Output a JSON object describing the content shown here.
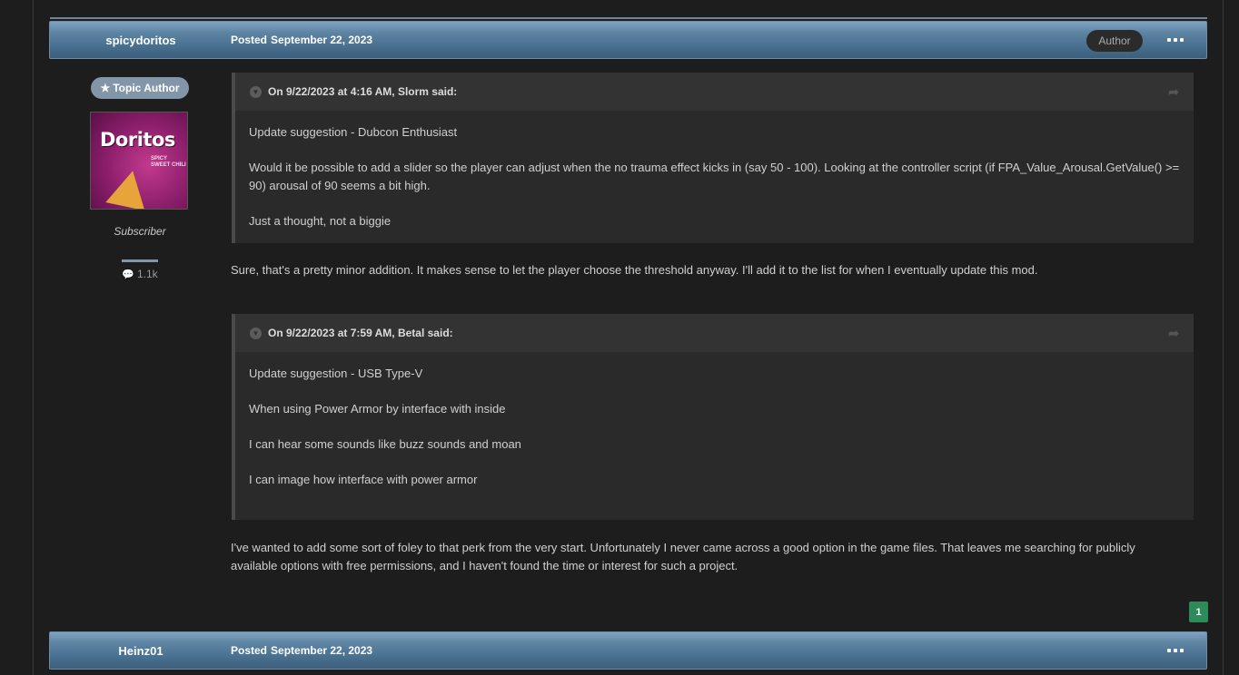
{
  "posts": [
    {
      "username": "spicydoritos",
      "posted_label": "Posted",
      "posted_date": "September 22, 2023",
      "author_badge": "Author",
      "topic_author_badge": "Topic Author",
      "avatar_logo": "Doritos",
      "avatar_flavor": "SPICY SWEET CHILI",
      "member_title": "Subscriber",
      "post_count": "1.1k",
      "quotes": [
        {
          "header": "On 9/22/2023 at 4:16 AM, Slorm said:",
          "lines": [
            "Update suggestion - Dubcon Enthusiast",
            "Would it be possible to add a slider so the player can adjust when the no trauma effect kicks in (say 50 - 100). Looking at the controller script (if FPA_Value_Arousal.GetValue() >= 90) arousal of 90 seems a bit high.",
            "Just a thought, not a biggie"
          ]
        },
        {
          "header": "On 9/22/2023 at 7:59 AM, Betal said:",
          "lines": [
            "Update suggestion - USB Type-V",
            "When using Power Armor by interface with inside",
            "I can hear some sounds like buzz sounds and moan",
            "I can image how interface with power armor"
          ]
        }
      ],
      "replies": [
        "Sure, that's a pretty minor addition.  It makes sense to let the player choose the threshold anyway.  I'll add it to the list for when I eventually update this mod.",
        "I've wanted to add some sort of foley to that perk from the very start.  Unfortunately I never came across a good option in the game files.  That leaves me searching for publicly available options with free permissions, and I haven't found the time or interest for such a project."
      ],
      "reaction_count": "1"
    },
    {
      "username": "Heinz01",
      "posted_label": "Posted",
      "posted_date": "September 22, 2023"
    }
  ],
  "icons": {
    "more": "more-options-icon",
    "star": "star-icon",
    "comment": "comment-bubble-icon",
    "collapse": "collapse-chevron-icon",
    "share": "share-arrow-icon"
  },
  "colors": {
    "header_gradient_top": "#7fa3bf",
    "header_gradient_bottom": "#3c5f7c",
    "badge": "#8396a9",
    "reaction": "#2e8a5a"
  }
}
